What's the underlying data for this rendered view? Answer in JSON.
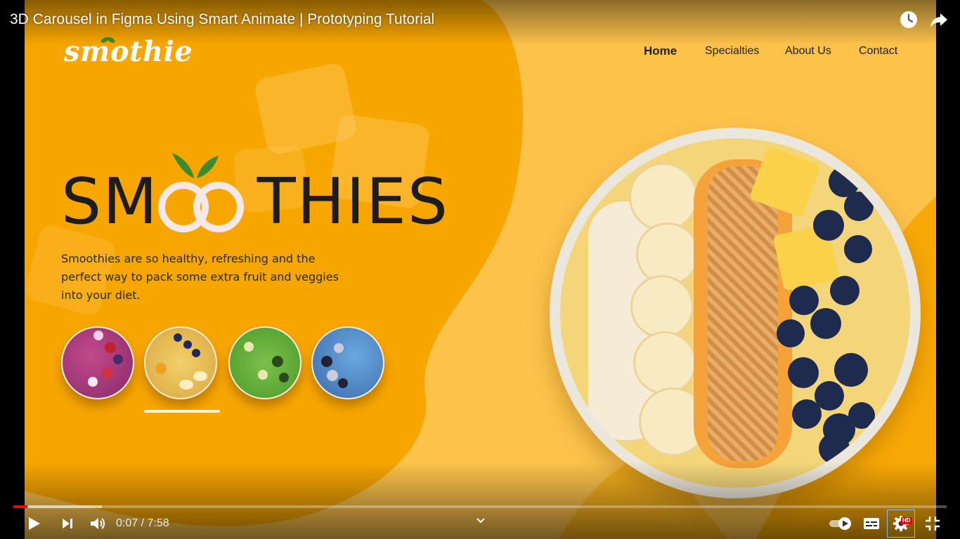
{
  "video": {
    "title": "3D Carousel in Figma Using Smart Animate | Prototyping Tutorial",
    "current_time": "0:07",
    "duration": "7:58",
    "time_display": "0:07 / 7:58",
    "progress_fraction": 0.015,
    "buffered_fraction": 0.095,
    "hd_label": "HD",
    "icons": {
      "watch_later": "clock-icon",
      "share": "share-icon",
      "play": "play-icon",
      "next": "next-icon",
      "volume": "volume-icon",
      "chapters": "chevron-down-icon",
      "autoplay": "autoplay-toggle-icon",
      "captions": "captions-icon",
      "settings": "gear-icon",
      "fullscreen": "exit-fullscreen-icon"
    }
  },
  "site": {
    "logo": "smothie",
    "nav": [
      {
        "label": "Home",
        "active": true
      },
      {
        "label": "Specialties",
        "active": false
      },
      {
        "label": "About Us",
        "active": false
      },
      {
        "label": "Contact",
        "active": false
      }
    ],
    "hero_title_left": "SM",
    "hero_title_right": "THIES",
    "hero_text": "Smoothies are so healthy, refreshing and the perfect way to pack some extra fruit and veggies into your diet.",
    "selected_thumb_index": 1,
    "thumbs": [
      "berry-bowl",
      "mango-banana-bowl",
      "green-kiwi-bowl",
      "blue-berry-bowl"
    ]
  },
  "colors": {
    "primary_orange": "#f7a600",
    "light_yellow": "#fcc24a",
    "leaf_green": "#3a8b2e",
    "progress_red": "#ff0000"
  }
}
